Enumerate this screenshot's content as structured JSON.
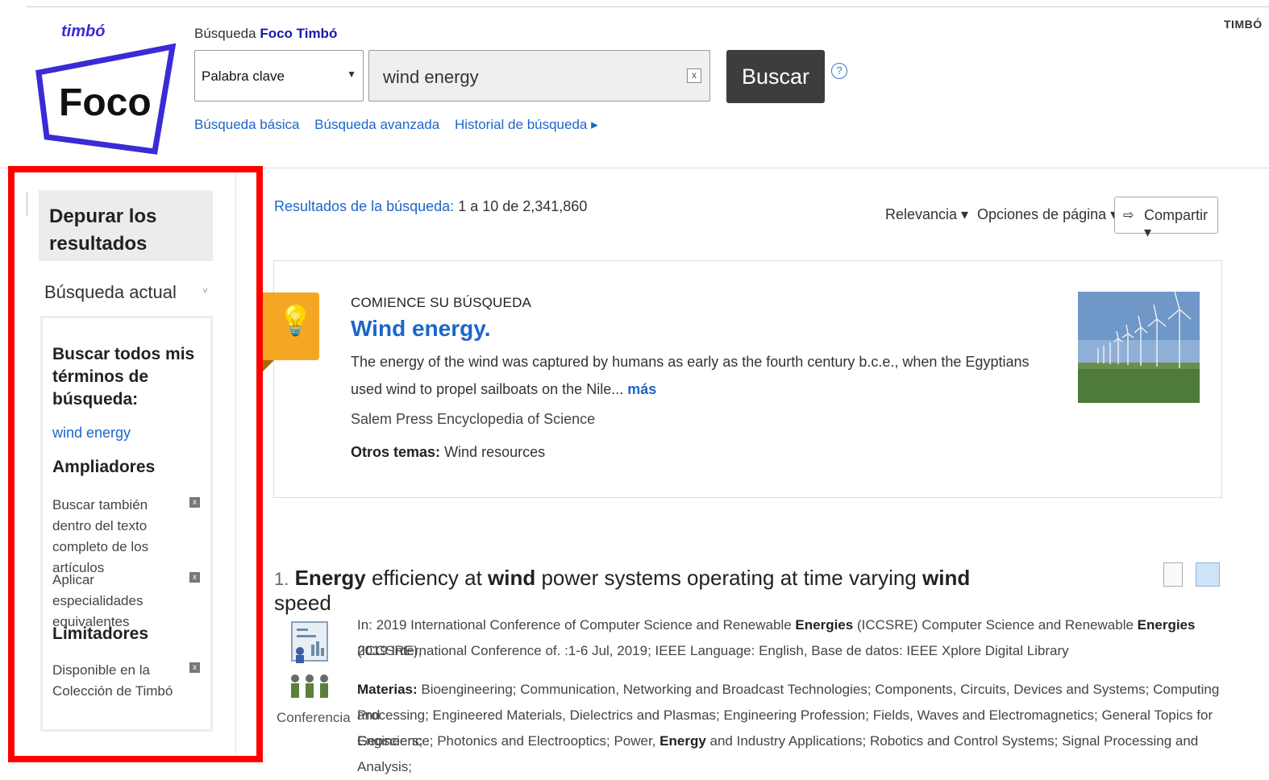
{
  "header": {
    "brand_corner": "TIMBÓ",
    "logo_small": "timbó",
    "logo_text": "Foco",
    "search_label_prefix": "Búsqueda",
    "search_label_brand": "Foco Timbó",
    "field_select": "Palabra clave",
    "query": "wind energy",
    "clear_label": "x",
    "search_button": "Buscar",
    "help_label": "?",
    "links": [
      "Búsqueda básica",
      "Búsqueda avanzada",
      "Historial de búsqueda ▸"
    ]
  },
  "sidebar": {
    "refine_title": "Depurar los resultados",
    "current_search": "Búsqueda actual",
    "current_chevron": "˅",
    "search_all_title": "Buscar todos mis términos de búsqueda:",
    "term": "wind energy",
    "expanders_title": "Ampliadores",
    "expanders": [
      "Buscar también dentro del texto completo de los artículos",
      "Aplicar especialidades equivalentes"
    ],
    "limiters_title": "Limitadores",
    "limiters": [
      "Disponible en la Colección de Timbó"
    ],
    "remove_label": "x"
  },
  "results_header": {
    "count_link": "Resultados de la búsqueda:",
    "count_text": "1 a 10 de 2,341,860",
    "sort": "Relevancia ▾",
    "page_options": "Opciones de página ▾",
    "share_icon": "⇨",
    "share": "Compartir ▾"
  },
  "starter": {
    "kicker": "COMIENCE SU BÚSQUEDA",
    "title": "Wind energy.",
    "description": "The energy of the wind was captured by humans as early as the fourth century b.c.e., when the Egyptians used wind to propel sailboats on the Nile...",
    "more": "más",
    "source": "Salem Press Encyclopedia of Science",
    "other_label": "Otros temas:",
    "other_value": "Wind resources",
    "icon": "lightbulb-icon"
  },
  "results": [
    {
      "number": "1.",
      "title_parts": [
        {
          "text": "Energy",
          "bold": true
        },
        {
          "text": " efficiency at ",
          "bold": false
        },
        {
          "text": "wind",
          "bold": true
        },
        {
          "text": " power systems operating at time varying ",
          "bold": false
        },
        {
          "text": "wind",
          "bold": true
        },
        {
          "text": " speed",
          "bold": false
        }
      ],
      "type": "Conferencia",
      "source_line1_a": "In: 2019 International Conference of Computer Science and Renewable ",
      "source_line1_b": "Energies",
      "source_line1_c": " (ICCSRE) Computer Science and Renewable ",
      "source_line1_d": "Energies",
      "source_line1_e": " (ICCSRE),",
      "source_line2": "2019 International Conference of. :1-6 Jul, 2019; IEEE Language: English, Base de datos: IEEE Xplore Digital Library",
      "subjects_label": "Materias:",
      "subjects_line1": " Bioengineering; Communication, Networking and Broadcast Technologies; Components, Circuits, Devices and Systems; Computing and",
      "subjects_line2": "Processing; Engineered Materials, Dielectrics and Plasmas; Engineering Profession; Fields, Waves and Electromagnetics; General Topics for Engineers;",
      "subjects_line3_a": "Geoscience; Photonics and Electrooptics; Power, ",
      "subjects_line3_b": "Energy",
      "subjects_line3_c": " and Industry Applications; Robotics and Control Systems; Signal Processing and Analysis;"
    }
  ]
}
